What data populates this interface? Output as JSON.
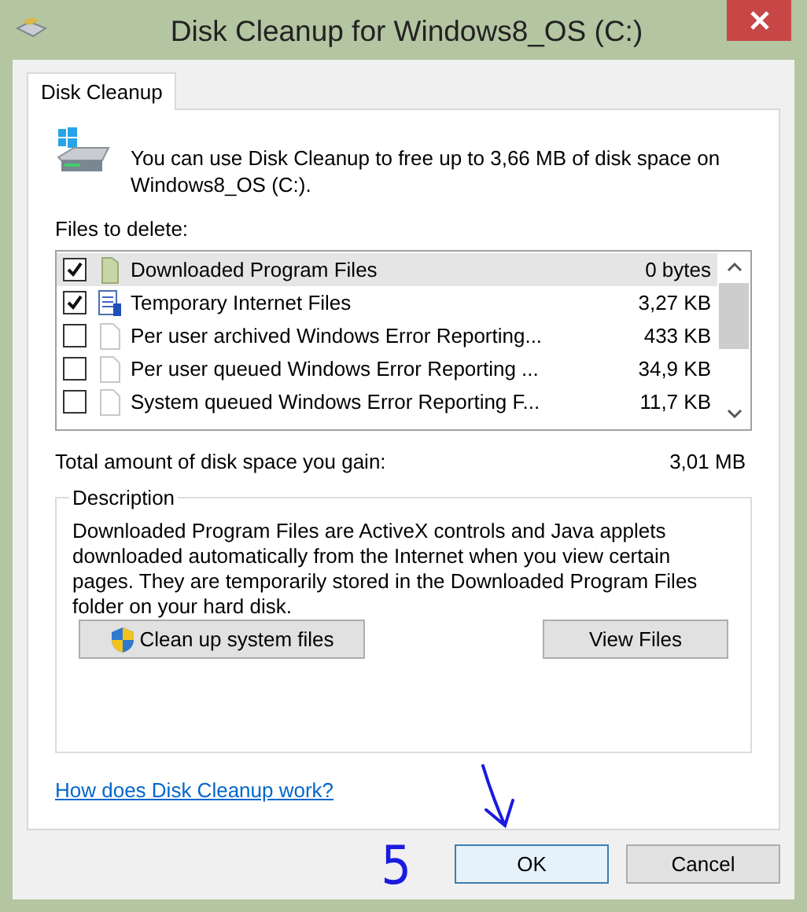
{
  "window": {
    "title": "Disk Cleanup for Windows8_OS (C:)"
  },
  "tabs": [
    {
      "label": "Disk Cleanup",
      "selected": true
    }
  ],
  "intro": "You can use Disk Cleanup to free up to 3,66 MB of disk space on Windows8_OS (C:).",
  "files_label": "Files to delete:",
  "files": [
    {
      "name": "Downloaded Program Files",
      "size": "0 bytes",
      "checked": true,
      "selected": true,
      "kind": "folder"
    },
    {
      "name": "Temporary Internet Files",
      "size": "3,27 KB",
      "checked": true,
      "selected": false,
      "kind": "document"
    },
    {
      "name": "Per user archived Windows Error Reporting...",
      "size": "433 KB",
      "checked": false,
      "selected": false,
      "kind": "blank"
    },
    {
      "name": "Per user queued Windows Error Reporting ...",
      "size": "34,9 KB",
      "checked": false,
      "selected": false,
      "kind": "blank"
    },
    {
      "name": "System queued Windows Error Reporting F...",
      "size": "11,7 KB",
      "checked": false,
      "selected": false,
      "kind": "blank"
    }
  ],
  "total": {
    "label": "Total amount of disk space you gain:",
    "value": "3,01 MB"
  },
  "description": {
    "title": "Description",
    "text": "Downloaded Program Files are ActiveX controls and Java applets downloaded automatically from the Internet when you view certain pages. They are temporarily stored in the Downloaded Program Files folder on your hard disk."
  },
  "panel_buttons": [
    {
      "label": "Clean up system files",
      "kind": "shield"
    },
    {
      "label": "View Files",
      "kind": "plain"
    }
  ],
  "help_link": "How does Disk Cleanup work?",
  "buttons": [
    {
      "label": "OK",
      "default": true
    },
    {
      "label": "Cancel",
      "default": false
    }
  ],
  "annotation": {
    "step": "5"
  }
}
